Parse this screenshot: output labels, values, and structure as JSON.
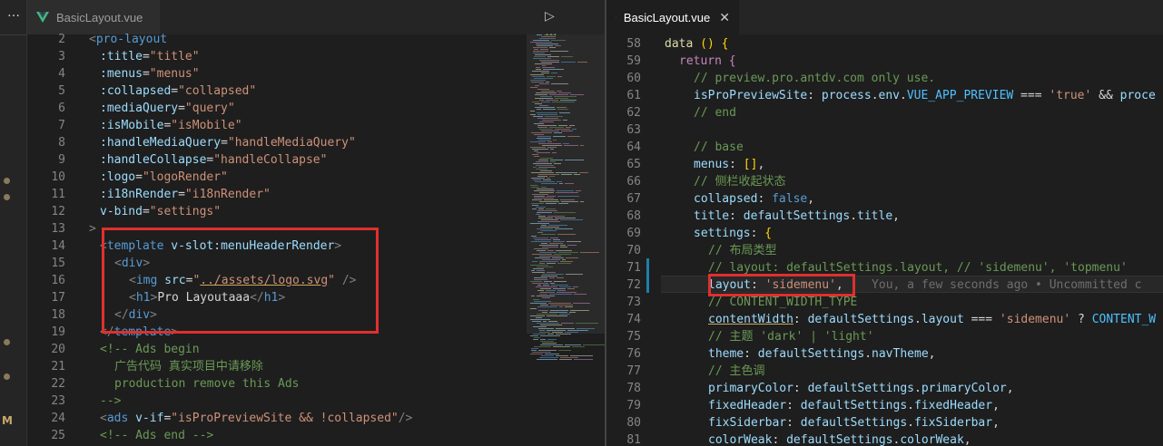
{
  "left": {
    "tab_title": "BasicLayout.vue",
    "tab_close": "✕",
    "tab_actions": "▷ …",
    "lines": [
      {
        "n": "2",
        "html_tokens": [
          [
            "p",
            "<"
          ],
          [
            "t",
            "pro-layout"
          ]
        ]
      },
      {
        "n": "3",
        "html_tokens": [
          [
            "a",
            ":title"
          ],
          [
            "w",
            "="
          ],
          [
            "s",
            "\"title\""
          ]
        ]
      },
      {
        "n": "4",
        "html_tokens": [
          [
            "a",
            ":menus"
          ],
          [
            "w",
            "="
          ],
          [
            "s",
            "\"menus\""
          ]
        ]
      },
      {
        "n": "5",
        "html_tokens": [
          [
            "a",
            ":collapsed"
          ],
          [
            "w",
            "="
          ],
          [
            "s",
            "\"collapsed\""
          ]
        ]
      },
      {
        "n": "6",
        "html_tokens": [
          [
            "a",
            ":mediaQuery"
          ],
          [
            "w",
            "="
          ],
          [
            "s",
            "\"query\""
          ]
        ]
      },
      {
        "n": "7",
        "html_tokens": [
          [
            "a",
            ":isMobile"
          ],
          [
            "w",
            "="
          ],
          [
            "s",
            "\"isMobile\""
          ]
        ]
      },
      {
        "n": "8",
        "html_tokens": [
          [
            "a",
            ":handleMediaQuery"
          ],
          [
            "w",
            "="
          ],
          [
            "s",
            "\"handleMediaQuery\""
          ]
        ]
      },
      {
        "n": "9",
        "html_tokens": [
          [
            "a",
            ":handleCollapse"
          ],
          [
            "w",
            "="
          ],
          [
            "s",
            "\"handleCollapse\""
          ]
        ]
      },
      {
        "n": "10",
        "html_tokens": [
          [
            "a",
            ":logo"
          ],
          [
            "w",
            "="
          ],
          [
            "s",
            "\"logoRender\""
          ]
        ]
      },
      {
        "n": "11",
        "html_tokens": [
          [
            "a",
            ":i18nRender"
          ],
          [
            "w",
            "="
          ],
          [
            "s",
            "\"i18nRender\""
          ]
        ]
      },
      {
        "n": "12",
        "html_tokens": [
          [
            "a",
            "v-bind"
          ],
          [
            "w",
            "="
          ],
          [
            "s",
            "\"settings\""
          ]
        ]
      },
      {
        "n": "13",
        "html_tokens": [
          [
            "p",
            ">"
          ]
        ]
      },
      {
        "n": "14",
        "html_tokens": [
          [
            "p",
            "<"
          ],
          [
            "t",
            "template"
          ],
          [
            "w",
            " "
          ],
          [
            "a",
            "v-slot:menuHeaderRender"
          ],
          [
            "p",
            ">"
          ]
        ]
      },
      {
        "n": "15",
        "html_tokens": [
          [
            "p",
            "<"
          ],
          [
            "t",
            "div"
          ],
          [
            "p",
            ">"
          ]
        ]
      },
      {
        "n": "16",
        "html_tokens": [
          [
            "p",
            "<"
          ],
          [
            "t",
            "img"
          ],
          [
            "w",
            " "
          ],
          [
            "a",
            "src"
          ],
          [
            "w",
            "="
          ],
          [
            "s",
            "\""
          ],
          [
            "su",
            "../assets/logo.svg"
          ],
          [
            "s",
            "\""
          ],
          [
            "w",
            " "
          ],
          [
            "p",
            "/>"
          ]
        ]
      },
      {
        "n": "17",
        "html_tokens": [
          [
            "p",
            "<"
          ],
          [
            "t",
            "h1"
          ],
          [
            "p",
            ">"
          ],
          [
            "w",
            "Pro Layoutaaa"
          ],
          [
            "p",
            "</"
          ],
          [
            "t",
            "h1"
          ],
          [
            "p",
            ">"
          ]
        ]
      },
      {
        "n": "18",
        "html_tokens": [
          [
            "p",
            "</"
          ],
          [
            "t",
            "div"
          ],
          [
            "p",
            ">"
          ]
        ]
      },
      {
        "n": "19",
        "html_tokens": [
          [
            "p",
            "</"
          ],
          [
            "t",
            "template"
          ],
          [
            "p",
            ">"
          ]
        ]
      },
      {
        "n": "20",
        "html_tokens": [
          [
            "c",
            "<!-- Ads begin"
          ]
        ]
      },
      {
        "n": "21",
        "html_tokens": [
          [
            "c",
            "广告代码 真实项目中请移除"
          ]
        ]
      },
      {
        "n": "22",
        "html_tokens": [
          [
            "c",
            "production remove this Ads"
          ]
        ]
      },
      {
        "n": "23",
        "html_tokens": [
          [
            "c",
            "-->"
          ]
        ]
      },
      {
        "n": "24",
        "html_tokens": [
          [
            "p",
            "<"
          ],
          [
            "t",
            "ads"
          ],
          [
            "w",
            " "
          ],
          [
            "a",
            "v-if"
          ],
          [
            "w",
            "="
          ],
          [
            "s",
            "\"isProPreviewSite && !collapsed\""
          ],
          [
            "p",
            "/>"
          ]
        ]
      },
      {
        "n": "25",
        "html_tokens": [
          [
            "c",
            "<!-- Ads end -->"
          ]
        ]
      },
      {
        "n": "26",
        "html_tokens": []
      }
    ]
  },
  "right": {
    "tab_title": "BasicLayout.vue",
    "tab_close": "✕",
    "lines": [
      {
        "n": "58",
        "html_tokens": [
          [
            "f",
            "data"
          ],
          [
            "w",
            " "
          ],
          [
            "y",
            "()"
          ],
          [
            "w",
            " "
          ],
          [
            "y",
            "{"
          ]
        ]
      },
      {
        "n": "59",
        "html_tokens": [
          [
            "m",
            "return"
          ],
          [
            "w",
            " "
          ],
          [
            "m",
            "{"
          ]
        ]
      },
      {
        "n": "60",
        "html_tokens": [
          [
            "c",
            "// preview.pro.antdv.com only use."
          ]
        ]
      },
      {
        "n": "61",
        "html_tokens": [
          [
            "a",
            "isProPreviewSite"
          ],
          [
            "w",
            ": "
          ],
          [
            "a",
            "process"
          ],
          [
            "w",
            "."
          ],
          [
            "a",
            "env"
          ],
          [
            "w",
            "."
          ],
          [
            "cst",
            "VUE_APP_PREVIEW"
          ],
          [
            "w",
            " === "
          ],
          [
            "s",
            "'true'"
          ],
          [
            "w",
            " && "
          ],
          [
            "a",
            "proce"
          ]
        ]
      },
      {
        "n": "62",
        "html_tokens": [
          [
            "c",
            "// end"
          ]
        ]
      },
      {
        "n": "63",
        "html_tokens": []
      },
      {
        "n": "64",
        "html_tokens": [
          [
            "c",
            "// base"
          ]
        ]
      },
      {
        "n": "65",
        "html_tokens": [
          [
            "a",
            "menus"
          ],
          [
            "w",
            ": "
          ],
          [
            "y",
            "[]"
          ],
          [
            "w",
            ","
          ]
        ]
      },
      {
        "n": "66",
        "html_tokens": [
          [
            "c",
            "// 侧栏收起状态"
          ]
        ]
      },
      {
        "n": "67",
        "html_tokens": [
          [
            "a",
            "collapsed"
          ],
          [
            "w",
            ": "
          ],
          [
            "k",
            "false"
          ],
          [
            "w",
            ","
          ]
        ]
      },
      {
        "n": "68",
        "html_tokens": [
          [
            "a",
            "title"
          ],
          [
            "w",
            ": "
          ],
          [
            "a",
            "defaultSettings"
          ],
          [
            "w",
            "."
          ],
          [
            "a",
            "title"
          ],
          [
            "w",
            ","
          ]
        ]
      },
      {
        "n": "69",
        "html_tokens": [
          [
            "a",
            "settings"
          ],
          [
            "w",
            ": "
          ],
          [
            "y",
            "{"
          ]
        ]
      },
      {
        "n": "70",
        "html_tokens": [
          [
            "c",
            "// 布局类型"
          ]
        ]
      },
      {
        "n": "71",
        "html_tokens": [
          [
            "c",
            "// layout: defaultSettings.layout, // 'sidemenu', 'topmenu'"
          ]
        ]
      },
      {
        "n": "72",
        "html_tokens": [
          [
            "a",
            "layout"
          ],
          [
            "w",
            ": "
          ],
          [
            "s",
            "'sidemenu'"
          ],
          [
            "w",
            ","
          ],
          [
            "w",
            "    "
          ],
          [
            "blame",
            "You, a few seconds ago • Uncommitted c"
          ]
        ]
      },
      {
        "n": "73",
        "html_tokens": [
          [
            "c",
            "// CONTENT_WIDTH_TYPE"
          ]
        ]
      },
      {
        "n": "74",
        "html_tokens": [
          [
            "au",
            "contentWidth"
          ],
          [
            "w",
            ": "
          ],
          [
            "a",
            "defaultSettings"
          ],
          [
            "w",
            "."
          ],
          [
            "a",
            "layout"
          ],
          [
            "w",
            " === "
          ],
          [
            "s",
            "'sidemenu'"
          ],
          [
            "w",
            " ? "
          ],
          [
            "cst",
            "CONTENT_W"
          ]
        ]
      },
      {
        "n": "75",
        "html_tokens": [
          [
            "c",
            "// 主题 'dark' | 'light'"
          ]
        ]
      },
      {
        "n": "76",
        "html_tokens": [
          [
            "a",
            "theme"
          ],
          [
            "w",
            ": "
          ],
          [
            "a",
            "defaultSettings"
          ],
          [
            "w",
            "."
          ],
          [
            "a",
            "navTheme"
          ],
          [
            "w",
            ","
          ]
        ]
      },
      {
        "n": "77",
        "html_tokens": [
          [
            "c",
            "// 主色调"
          ]
        ]
      },
      {
        "n": "78",
        "html_tokens": [
          [
            "a",
            "primaryColor"
          ],
          [
            "w",
            ": "
          ],
          [
            "a",
            "defaultSettings"
          ],
          [
            "w",
            "."
          ],
          [
            "a",
            "primaryColor"
          ],
          [
            "w",
            ","
          ]
        ]
      },
      {
        "n": "79",
        "html_tokens": [
          [
            "a",
            "fixedHeader"
          ],
          [
            "w",
            ": "
          ],
          [
            "a",
            "defaultSettings"
          ],
          [
            "w",
            "."
          ],
          [
            "a",
            "fixedHeader"
          ],
          [
            "w",
            ","
          ]
        ]
      },
      {
        "n": "80",
        "html_tokens": [
          [
            "a",
            "fixSiderbar"
          ],
          [
            "w",
            ": "
          ],
          [
            "a",
            "defaultSettings"
          ],
          [
            "w",
            "."
          ],
          [
            "a",
            "fixSiderbar"
          ],
          [
            "w",
            ","
          ]
        ]
      },
      {
        "n": "81",
        "html_tokens": [
          [
            "a",
            "colorWeak"
          ],
          [
            "w",
            ": "
          ],
          [
            "a",
            "defaultSettings"
          ],
          [
            "w",
            "."
          ],
          [
            "a",
            "colorWeak"
          ],
          [
            "w",
            ","
          ]
        ]
      }
    ]
  },
  "activity": {
    "dots": "…",
    "badge": "M"
  },
  "colors": {
    "highlight": "#e02f2f",
    "vue_green": "#41b883",
    "vue_dark": "#35495e"
  }
}
